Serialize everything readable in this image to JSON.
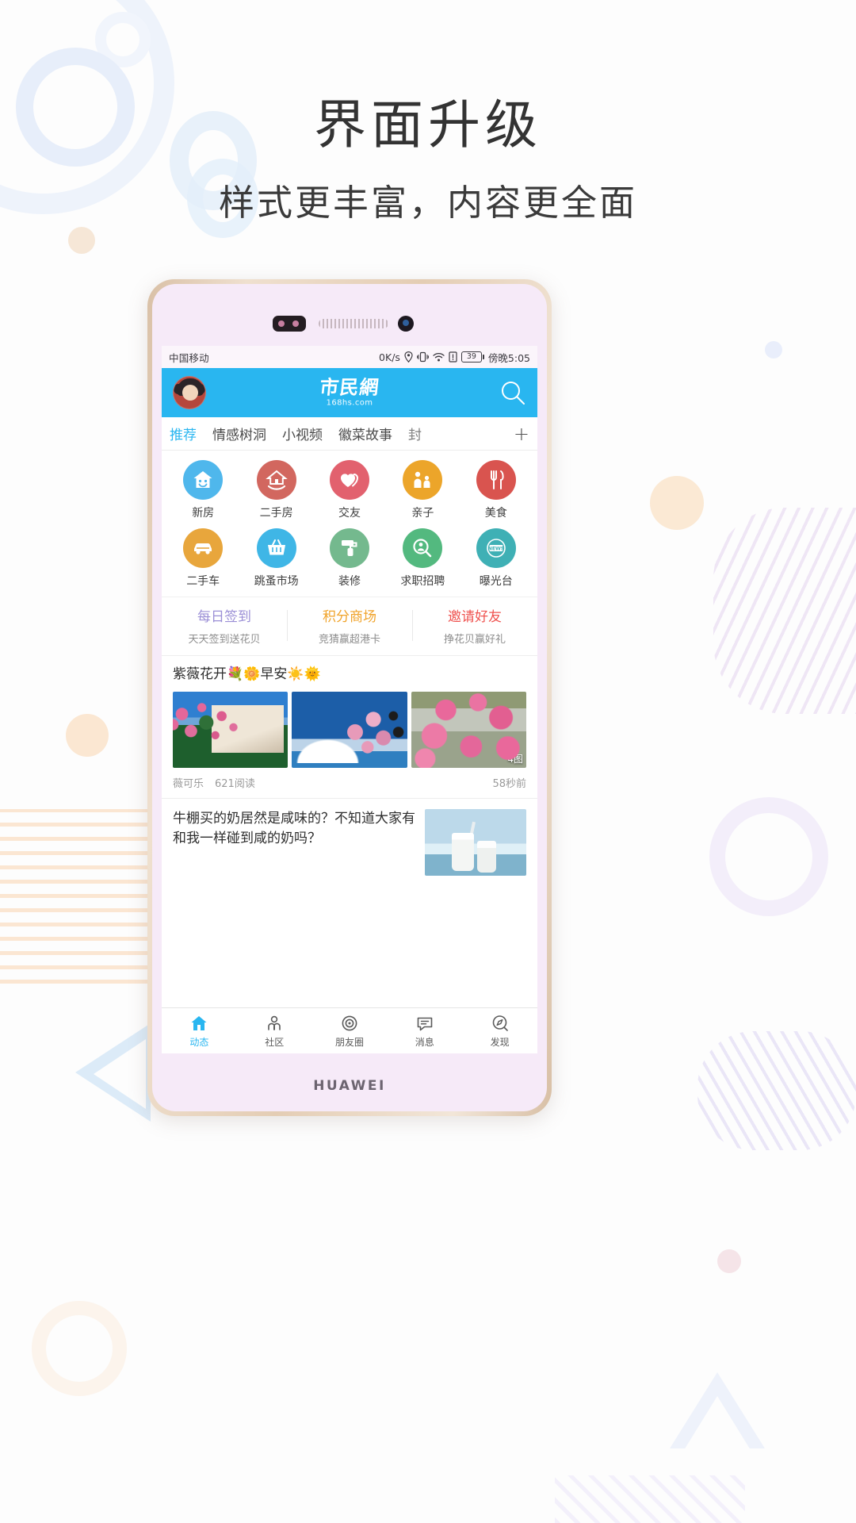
{
  "promo_page": {
    "headline": "界面升级",
    "subhead": "样式更丰富，内容更全面"
  },
  "phone": {
    "brand": "HUAWEI"
  },
  "statusbar": {
    "carrier": "中国移动",
    "network_speed": "0K/s",
    "icons": [
      "location-icon",
      "vibrate-icon",
      "wifi-icon",
      "sim-icon"
    ],
    "battery_level": "39",
    "time": "傍晚5:05"
  },
  "appbar": {
    "avatar_name": "user-avatar",
    "logo_cn": "市民網",
    "logo_en": "168hs.com",
    "search_icon": "search-icon"
  },
  "tabs": {
    "items": [
      {
        "label": "推荐",
        "active": true
      },
      {
        "label": "情感树洞",
        "active": false
      },
      {
        "label": "小视频",
        "active": false
      },
      {
        "label": "徽菜故事",
        "active": false
      },
      {
        "label": "封",
        "active": false
      }
    ],
    "add_label": "+"
  },
  "grid": {
    "items": [
      {
        "label": "新房",
        "icon": "house-smile-icon",
        "color": "#4fb7ec"
      },
      {
        "label": "二手房",
        "icon": "house-hand-icon",
        "color": "#d2675f"
      },
      {
        "label": "交友",
        "icon": "two-hearts-icon",
        "color": "#e2616e"
      },
      {
        "label": "亲子",
        "icon": "parent-child-icon",
        "color": "#eca52a"
      },
      {
        "label": "美食",
        "icon": "fork-knife-icon",
        "color": "#d9544f"
      },
      {
        "label": "二手车",
        "icon": "car-icon",
        "color": "#e8a63c"
      },
      {
        "label": "跳蚤市场",
        "icon": "basket-icon",
        "color": "#3fb6e6"
      },
      {
        "label": "装修",
        "icon": "paint-roller-icon",
        "color": "#74b98e"
      },
      {
        "label": "求职招聘",
        "icon": "job-search-icon",
        "color": "#53b97f"
      },
      {
        "label": "曝光台",
        "icon": "news-badge-icon",
        "color": "#3fb0b5"
      }
    ]
  },
  "promo_row": {
    "items": [
      {
        "title": "每日签到",
        "subtitle": "天天签到送花贝",
        "color": "#9b8fd6"
      },
      {
        "title": "积分商场",
        "subtitle": "竞猜赢超港卡",
        "color": "#f0a32a"
      },
      {
        "title": "邀请好友",
        "subtitle": "挣花贝赢好礼",
        "color": "#ef5350"
      }
    ]
  },
  "feed": {
    "post1": {
      "title": "紫薇花开💐🌼早安☀️🌞",
      "thumbs": [
        "crape-myrtle-house-photo",
        "crape-myrtle-sky-photo",
        "crape-myrtle-close-photo"
      ],
      "image_count_badge": "4图",
      "author": "薇可乐",
      "reads": "621阅读",
      "time": "58秒前"
    },
    "post2": {
      "title": "牛棚买的奶居然是咸味的？不知道大家有和我一样碰到咸的奶吗？",
      "thumb": "milk-glass-photo"
    }
  },
  "bottomnav": {
    "items": [
      {
        "label": "动态",
        "icon": "home-icon",
        "active": true
      },
      {
        "label": "社区",
        "icon": "community-icon",
        "active": false
      },
      {
        "label": "朋友圈",
        "icon": "moments-icon",
        "active": false
      },
      {
        "label": "消息",
        "icon": "message-icon",
        "active": false
      },
      {
        "label": "发现",
        "icon": "discover-icon",
        "active": false
      }
    ]
  },
  "colors": {
    "brand_blue": "#29b6f0",
    "phone_body": "#e4cdb4",
    "screen_bg": "#ffffff"
  }
}
